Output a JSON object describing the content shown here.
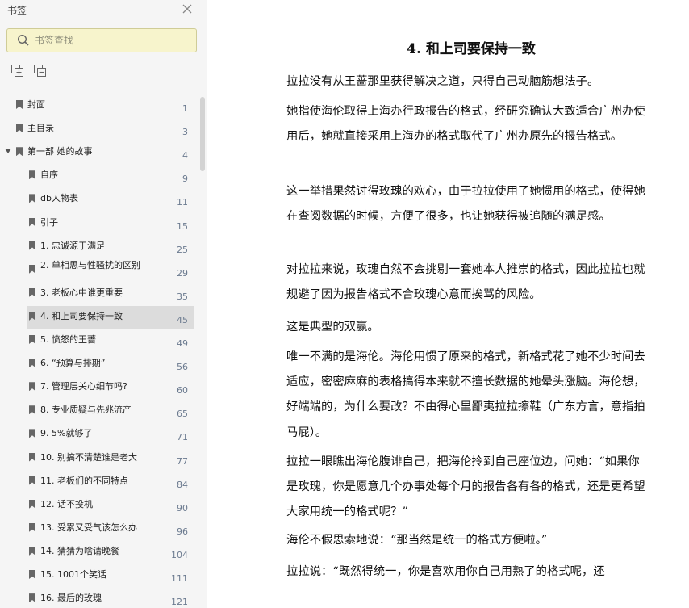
{
  "sidebar": {
    "title": "书签",
    "search_placeholder": "书签查找",
    "items": [
      {
        "label": "封面",
        "page": "1",
        "level": 0
      },
      {
        "label": "主目录",
        "page": "3",
        "level": 0
      },
      {
        "label": "第一部 她的故事",
        "page": "4",
        "level": 0,
        "expanded": true
      },
      {
        "label": "自序",
        "page": "9",
        "level": 1
      },
      {
        "label": "db人物表",
        "page": "11",
        "level": 1
      },
      {
        "label": "引子",
        "page": "15",
        "level": 1
      },
      {
        "label": "1. 忠诚源于满足",
        "page": "25",
        "level": 1
      },
      {
        "label": "2. 单相思与性骚扰的区别",
        "page": "29",
        "level": 1
      },
      {
        "label": "3. 老板心中谁更重要",
        "page": "35",
        "level": 1
      },
      {
        "label": "4. 和上司要保持一致",
        "page": "45",
        "level": 1,
        "selected": true
      },
      {
        "label": "5. 愤怒的王蔷",
        "page": "49",
        "level": 1
      },
      {
        "label": "6. “预算与排期”",
        "page": "56",
        "level": 1
      },
      {
        "label": "7. 管理层关心细节吗?",
        "page": "60",
        "level": 1
      },
      {
        "label": "8. 专业质疑与先兆流产",
        "page": "65",
        "level": 1
      },
      {
        "label": "9. 5%就够了",
        "page": "71",
        "level": 1
      },
      {
        "label": "10. 别搞不清楚谁是老大",
        "page": "77",
        "level": 1
      },
      {
        "label": "11. 老板们的不同特点",
        "page": "84",
        "level": 1
      },
      {
        "label": "12. 话不投机",
        "page": "90",
        "level": 1
      },
      {
        "label": "13. 受累又受气该怎么办",
        "page": "96",
        "level": 1
      },
      {
        "label": "14. 猜猜为啥请晚餐",
        "page": "104",
        "level": 1
      },
      {
        "label": "15. 1001个笑话",
        "page": "111",
        "level": 1
      },
      {
        "label": "16. 最后的玫瑰",
        "page": "121",
        "level": 1
      }
    ]
  },
  "content": {
    "chapter_title": "4. 和上司要保持一致",
    "paragraphs": [
      "拉拉没有从王蔷那里获得解决之道，只得自己动脑筋想法子。",
      "她指使海伦取得上海办行政报告的格式，经研究确认大致适合广州办使用后，她就直接采用上海办的格式取代了广州办原先的报告格式。",
      "这一举措果然讨得玫瑰的欢心，由于拉拉使用了她惯用的格式，使得她在查阅数据的时候，方便了很多，也让她获得被追随的满足感。",
      "对拉拉来说，玫瑰自然不会挑剔一套她本人推崇的格式，因此拉拉也就规避了因为报告格式不合玫瑰心意而挨骂的风险。",
      "这是典型的双赢。",
      "唯一不满的是海伦。海伦用惯了原来的格式，新格式花了她不少时间去适应，密密麻麻的表格搞得本来就不擅长数据的她晕头涨脑。海伦想，好端端的，为什么要改？不由得心里鄙夷拉拉擦鞋（广东方言，意指拍马屁）。",
      "拉拉一眼瞧出海伦腹诽自己，把海伦拎到自己座位边，问她：“如果你是玫瑰，你是愿意几个办事处每个月的报告各有各的格式，还是更希望大家用统一的格式呢？”",
      "海伦不假思索地说：“那当然是统一的格式方便啦。”",
      "拉拉说：“既然得统一，你是喜欢用你自己用熟了的格式呢，还"
    ]
  }
}
